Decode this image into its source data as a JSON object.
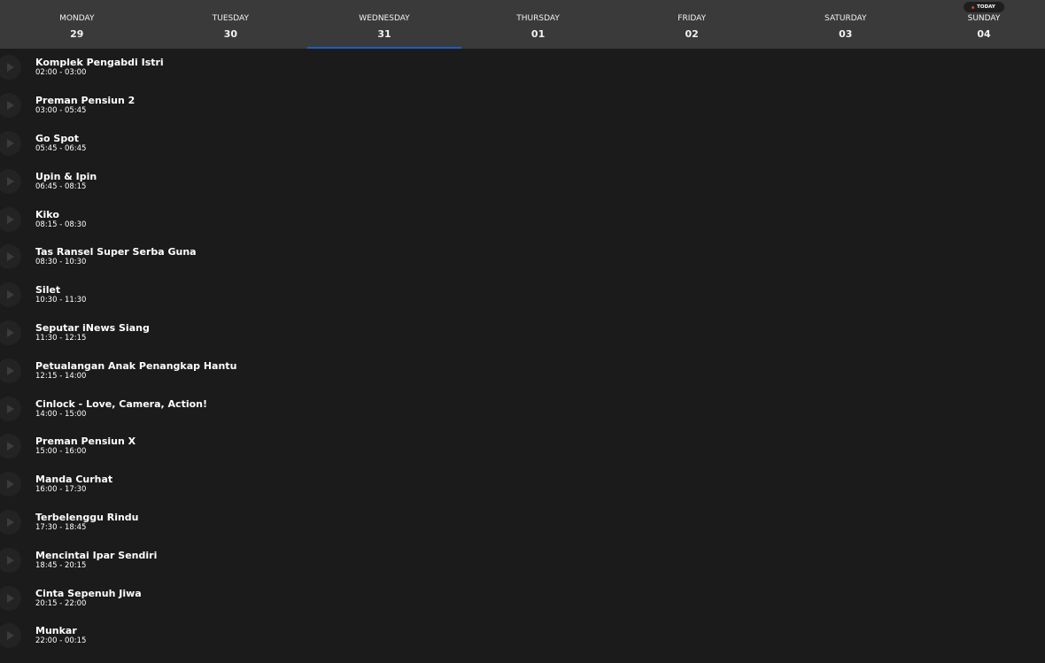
{
  "days": [
    {
      "name": "MONDAY",
      "num": "29"
    },
    {
      "name": "TUESDAY",
      "num": "30"
    },
    {
      "name": "WEDNESDAY",
      "num": "31"
    },
    {
      "name": "THURSDAY",
      "num": "01"
    },
    {
      "name": "FRIDAY",
      "num": "02"
    },
    {
      "name": "SATURDAY",
      "num": "03"
    },
    {
      "name": "SUNDAY",
      "num": "04"
    }
  ],
  "active_day_index": 2,
  "today_badge": "TODAY",
  "colors": {
    "accent": "#1f5fbf",
    "today_dot": "#e53935",
    "header_bg": "#3a3a3b",
    "page_bg": "#1b1b1c"
  },
  "programs": [
    {
      "title": "Komplek Pengabdi Istri",
      "time": "02:00 - 03:00"
    },
    {
      "title": "Preman Pensiun 2",
      "time": "03:00 - 05:45"
    },
    {
      "title": "Go Spot",
      "time": "05:45 - 06:45"
    },
    {
      "title": "Upin & Ipin",
      "time": "06:45 - 08:15"
    },
    {
      "title": "Kiko",
      "time": "08:15 - 08:30"
    },
    {
      "title": "Tas Ransel Super Serba Guna",
      "time": "08:30 - 10:30"
    },
    {
      "title": "Silet",
      "time": "10:30 - 11:30"
    },
    {
      "title": "Seputar iNews Siang",
      "time": "11:30 - 12:15"
    },
    {
      "title": "Petualangan Anak Penangkap Hantu",
      "time": "12:15 - 14:00"
    },
    {
      "title": "Cinlock - Love, Camera, Action!",
      "time": "14:00 - 15:00"
    },
    {
      "title": "Preman Pensiun X",
      "time": "15:00 - 16:00"
    },
    {
      "title": "Manda Curhat",
      "time": "16:00 - 17:30"
    },
    {
      "title": "Terbelenggu Rindu",
      "time": "17:30 - 18:45"
    },
    {
      "title": "Mencintai Ipar Sendiri",
      "time": "18:45 - 20:15"
    },
    {
      "title": "Cinta Sepenuh Jiwa",
      "time": "20:15 - 22:00"
    },
    {
      "title": "Munkar",
      "time": "22:00 - 00:15"
    }
  ]
}
